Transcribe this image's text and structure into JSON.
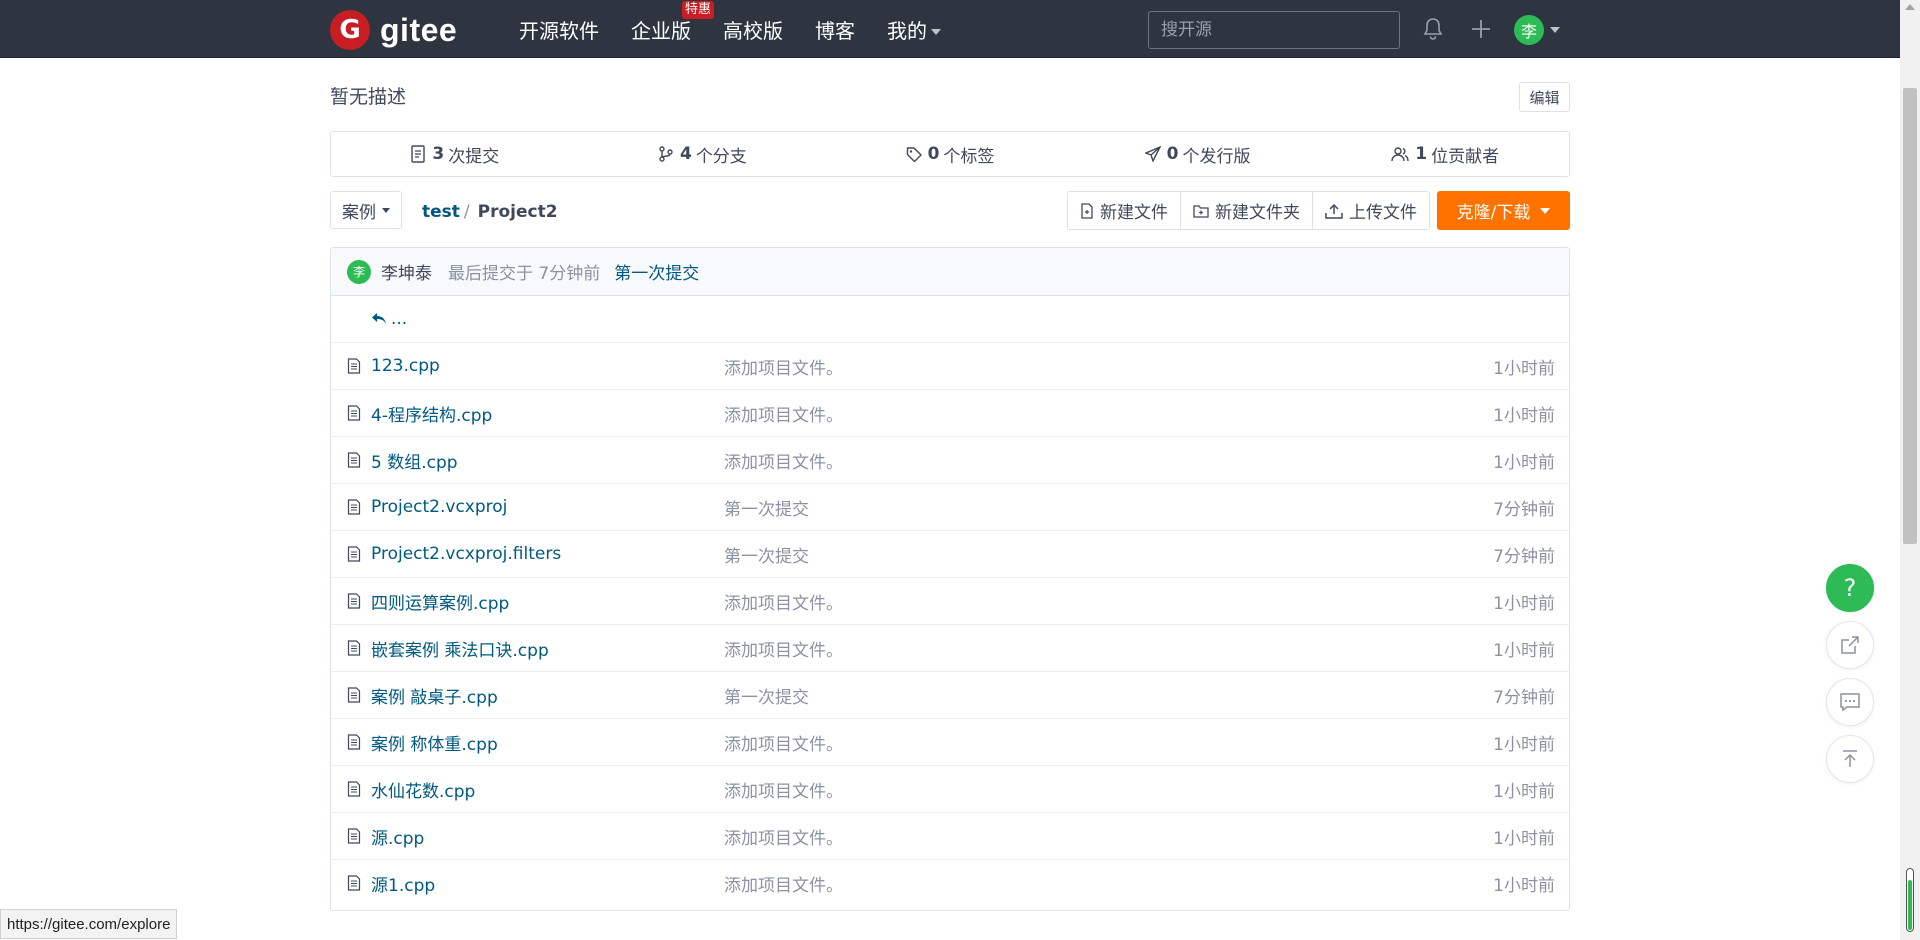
{
  "topbar": {
    "logo_letter": "G",
    "logo_text": "gitee",
    "nav": [
      {
        "label": "开源软件"
      },
      {
        "label": "企业版",
        "badge": "特惠"
      },
      {
        "label": "高校版"
      },
      {
        "label": "博客"
      },
      {
        "label": "我的",
        "dropdown": true
      }
    ],
    "search_placeholder": "搜开源",
    "avatar_letter": "李",
    "icons": [
      "bell-icon",
      "plus-icon"
    ]
  },
  "repo": {
    "description": "暂无描述",
    "edit_label": "编辑",
    "stats": [
      {
        "icon": "commit-icon",
        "count": "3",
        "label": "次提交"
      },
      {
        "icon": "branch-icon",
        "count": "4",
        "label": "个分支"
      },
      {
        "icon": "tag-icon",
        "count": "0",
        "label": "个标签"
      },
      {
        "icon": "release-icon",
        "count": "0",
        "label": "个发行版"
      },
      {
        "icon": "contributors-icon",
        "count": "1",
        "label": "位贡献者"
      }
    ],
    "branch": "案例",
    "breadcrumb": {
      "parent": "test",
      "separator": "/",
      "current": "Project2"
    },
    "actions": {
      "new_file": "新建文件",
      "new_folder": "新建文件夹",
      "upload": "上传文件",
      "clone": "克隆/下载"
    },
    "last_commit": {
      "avatar_letter": "李",
      "author": "李坤泰",
      "time_text": "最后提交于 7分钟前",
      "message": "第一次提交"
    },
    "back_label": "...",
    "files": [
      {
        "name": "123.cpp",
        "commit": "添加项目文件。",
        "time": "1小时前"
      },
      {
        "name": "4-程序结构.cpp",
        "commit": "添加项目文件。",
        "time": "1小时前"
      },
      {
        "name": "5 数组.cpp",
        "commit": "添加项目文件。",
        "time": "1小时前"
      },
      {
        "name": "Project2.vcxproj",
        "commit": "第一次提交",
        "time": "7分钟前"
      },
      {
        "name": "Project2.vcxproj.filters",
        "commit": "第一次提交",
        "time": "7分钟前"
      },
      {
        "name": "四则运算案例.cpp",
        "commit": "添加项目文件。",
        "time": "1小时前"
      },
      {
        "name": "嵌套案例 乘法口诀.cpp",
        "commit": "添加项目文件。",
        "time": "1小时前"
      },
      {
        "name": "案例 敲桌子.cpp",
        "commit": "第一次提交",
        "time": "7分钟前"
      },
      {
        "name": "案例 称体重.cpp",
        "commit": "添加项目文件。",
        "time": "1小时前"
      },
      {
        "name": "水仙花数.cpp",
        "commit": "添加项目文件。",
        "time": "1小时前"
      },
      {
        "name": "源.cpp",
        "commit": "添加项目文件。",
        "time": "1小时前"
      },
      {
        "name": "源1.cpp",
        "commit": "添加项目文件。",
        "time": "1小时前"
      }
    ]
  },
  "floating": {
    "help_label": "?"
  },
  "status_url": "https://gitee.com/explore",
  "colors": {
    "topbar": "#2e3440",
    "brand": "#c71d23",
    "accent": "#fe7300",
    "link": "#005980",
    "avatar": "#2dbb55"
  }
}
